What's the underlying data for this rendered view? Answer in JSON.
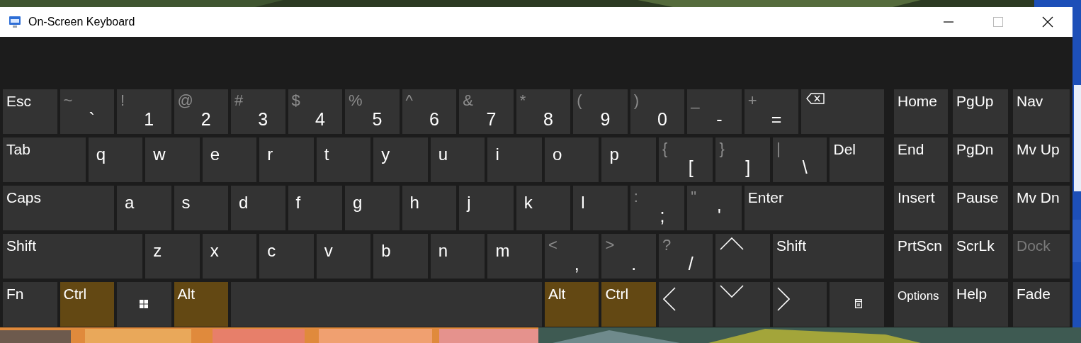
{
  "window": {
    "title": "On-Screen Keyboard"
  },
  "main_keys": [
    [
      {
        "kind": "word",
        "label": "Esc"
      },
      {
        "kind": "symbol",
        "shift": "~",
        "label": "`"
      },
      {
        "kind": "symbol",
        "shift": "!",
        "label": "1"
      },
      {
        "kind": "symbol",
        "shift": "@",
        "label": "2"
      },
      {
        "kind": "symbol",
        "shift": "#",
        "label": "3"
      },
      {
        "kind": "symbol",
        "shift": "$",
        "label": "4"
      },
      {
        "kind": "symbol",
        "shift": "%",
        "label": "5"
      },
      {
        "kind": "symbol",
        "shift": "^",
        "label": "6"
      },
      {
        "kind": "symbol",
        "shift": "&",
        "label": "7"
      },
      {
        "kind": "symbol",
        "shift": "*",
        "label": "8"
      },
      {
        "kind": "symbol",
        "shift": "(",
        "label": "9"
      },
      {
        "kind": "symbol",
        "shift": ")",
        "label": "0"
      },
      {
        "kind": "symbol",
        "shift": "_",
        "label": "-"
      },
      {
        "kind": "symbol",
        "shift": "+",
        "label": "="
      },
      {
        "kind": "backspace"
      }
    ],
    [
      {
        "kind": "word",
        "label": "Tab"
      },
      {
        "kind": "letter",
        "label": "q"
      },
      {
        "kind": "letter",
        "label": "w"
      },
      {
        "kind": "letter",
        "label": "e"
      },
      {
        "kind": "letter",
        "label": "r"
      },
      {
        "kind": "letter",
        "label": "t"
      },
      {
        "kind": "letter",
        "label": "y"
      },
      {
        "kind": "letter",
        "label": "u"
      },
      {
        "kind": "letter",
        "label": "i"
      },
      {
        "kind": "letter",
        "label": "o"
      },
      {
        "kind": "letter",
        "label": "p"
      },
      {
        "kind": "symbol",
        "shift": "{",
        "label": "["
      },
      {
        "kind": "symbol",
        "shift": "}",
        "label": "]"
      },
      {
        "kind": "symbol",
        "shift": "|",
        "label": "\\"
      },
      {
        "kind": "word",
        "label": "Del"
      }
    ],
    [
      {
        "kind": "word",
        "label": "Caps",
        "on": false
      },
      {
        "kind": "letter",
        "label": "a"
      },
      {
        "kind": "letter",
        "label": "s"
      },
      {
        "kind": "letter",
        "label": "d"
      },
      {
        "kind": "letter",
        "label": "f"
      },
      {
        "kind": "letter",
        "label": "g"
      },
      {
        "kind": "letter",
        "label": "h"
      },
      {
        "kind": "letter",
        "label": "j"
      },
      {
        "kind": "letter",
        "label": "k"
      },
      {
        "kind": "letter",
        "label": "l"
      },
      {
        "kind": "symbol",
        "shift": ":",
        "label": ";"
      },
      {
        "kind": "symbol",
        "shift": "\"",
        "label": "'"
      },
      {
        "kind": "word",
        "label": "Enter"
      }
    ],
    [
      {
        "kind": "word",
        "label": "Shift",
        "on": false
      },
      {
        "kind": "letter",
        "label": "z"
      },
      {
        "kind": "letter",
        "label": "x"
      },
      {
        "kind": "letter",
        "label": "c"
      },
      {
        "kind": "letter",
        "label": "v"
      },
      {
        "kind": "letter",
        "label": "b"
      },
      {
        "kind": "letter",
        "label": "n"
      },
      {
        "kind": "letter",
        "label": "m"
      },
      {
        "kind": "symbol",
        "shift": "<",
        "label": ","
      },
      {
        "kind": "symbol",
        "shift": ">",
        "label": "."
      },
      {
        "kind": "symbol",
        "shift": "?",
        "label": "/"
      },
      {
        "kind": "up"
      },
      {
        "kind": "word",
        "label": "Shift",
        "on": false
      }
    ],
    [
      {
        "kind": "word",
        "label": "Fn",
        "on": false
      },
      {
        "kind": "word",
        "label": "Ctrl",
        "on": true
      },
      {
        "kind": "windows"
      },
      {
        "kind": "word",
        "label": "Alt",
        "on": true
      },
      {
        "kind": "space"
      },
      {
        "kind": "word",
        "label": "Alt",
        "on": true
      },
      {
        "kind": "word",
        "label": "Ctrl",
        "on": true
      },
      {
        "kind": "left"
      },
      {
        "kind": "down"
      },
      {
        "kind": "right"
      },
      {
        "kind": "menu"
      }
    ]
  ],
  "side_keys": [
    {
      "kind": "word",
      "label": "Home",
      "disabled": false
    },
    {
      "kind": "word",
      "label": "PgUp",
      "disabled": false
    },
    {
      "kind": "word",
      "label": "Nav",
      "disabled": false
    },
    {
      "kind": "word",
      "label": "End",
      "disabled": false
    },
    {
      "kind": "word",
      "label": "PgDn",
      "disabled": false
    },
    {
      "kind": "word",
      "label": "Mv Up",
      "disabled": false
    },
    {
      "kind": "word",
      "label": "Insert",
      "disabled": false
    },
    {
      "kind": "word",
      "label": "Pause",
      "disabled": false
    },
    {
      "kind": "word",
      "label": "Mv Dn",
      "disabled": false
    },
    {
      "kind": "word",
      "label": "PrtScn",
      "disabled": false
    },
    {
      "kind": "word",
      "label": "ScrLk",
      "disabled": false
    },
    {
      "kind": "word",
      "label": "Dock",
      "disabled": true
    },
    {
      "kind": "small",
      "label": "Options",
      "disabled": false
    },
    {
      "kind": "word",
      "label": "Help",
      "disabled": false
    },
    {
      "kind": "word",
      "label": "Fade",
      "disabled": false
    }
  ]
}
